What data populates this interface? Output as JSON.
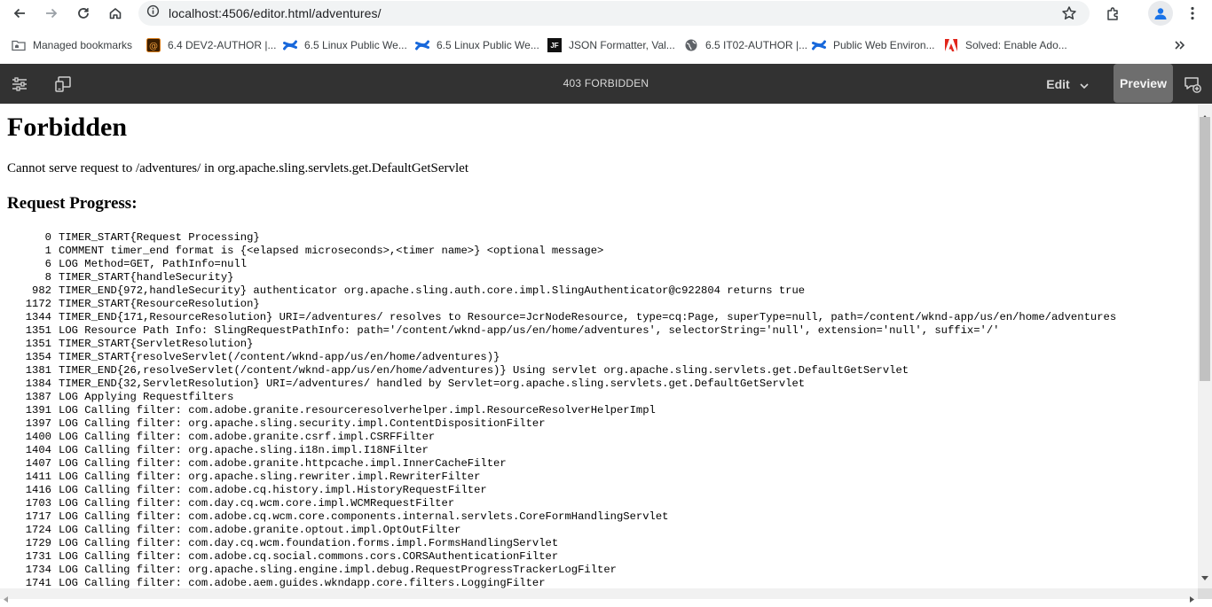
{
  "browser": {
    "url": "localhost:4506/editor.html/adventures/",
    "icons": [
      "back-icon",
      "forward-icon",
      "reload-icon",
      "home-icon",
      "site-info-icon",
      "bookmark-star-icon",
      "extensions-icon",
      "profile-icon",
      "browser-menu-icon"
    ]
  },
  "bookmarks": {
    "items": [
      {
        "label": "Managed bookmarks",
        "icon": "folder-icon"
      },
      {
        "label": "6.4 DEV2-AUTHOR |...",
        "icon": "aem-favicon"
      },
      {
        "label": "6.5 Linux Public We...",
        "icon": "confluence-favicon"
      },
      {
        "label": "6.5 Linux Public We...",
        "icon": "confluence-favicon"
      },
      {
        "label": "JSON Formatter, Val...",
        "icon": "jf-favicon"
      },
      {
        "label": "6.5 IT02-AUTHOR |...",
        "icon": "globe-favicon"
      },
      {
        "label": "Public Web Environ...",
        "icon": "confluence-favicon"
      },
      {
        "label": "Solved: Enable Ado...",
        "icon": "adobe-favicon"
      }
    ],
    "jf_favicon_text": "JF",
    "overflow_icon": "chevron-double-right-icon"
  },
  "editor": {
    "title": "403 FORBIDDEN",
    "mode_label": "Edit",
    "preview_label": "Preview",
    "icons": [
      "page-properties-icon",
      "emulator-icon",
      "annotate-icon"
    ]
  },
  "page": {
    "heading": "Forbidden",
    "message": "Cannot serve request to /adventures/ in org.apache.sling.servlets.get.DefaultGetServlet",
    "subheading": "Request Progress:",
    "log": [
      {
        "time": "0",
        "text": "TIMER_START{Request Processing}"
      },
      {
        "time": "1",
        "text": "COMMENT timer_end format is {<elapsed microseconds>,<timer name>} <optional message>"
      },
      {
        "time": "6",
        "text": "LOG Method=GET, PathInfo=null"
      },
      {
        "time": "8",
        "text": "TIMER_START{handleSecurity}"
      },
      {
        "time": "982",
        "text": "TIMER_END{972,handleSecurity} authenticator org.apache.sling.auth.core.impl.SlingAuthenticator@c922804 returns true"
      },
      {
        "time": "1172",
        "text": "TIMER_START{ResourceResolution}"
      },
      {
        "time": "1344",
        "text": "TIMER_END{171,ResourceResolution} URI=/adventures/ resolves to Resource=JcrNodeResource, type=cq:Page, superType=null, path=/content/wknd-app/us/en/home/adventures"
      },
      {
        "time": "1351",
        "text": "LOG Resource Path Info: SlingRequestPathInfo: path='/content/wknd-app/us/en/home/adventures', selectorString='null', extension='null', suffix='/'"
      },
      {
        "time": "1351",
        "text": "TIMER_START{ServletResolution}"
      },
      {
        "time": "1354",
        "text": "TIMER_START{resolveServlet(/content/wknd-app/us/en/home/adventures)}"
      },
      {
        "time": "1381",
        "text": "TIMER_END{26,resolveServlet(/content/wknd-app/us/en/home/adventures)} Using servlet org.apache.sling.servlets.get.DefaultGetServlet"
      },
      {
        "time": "1384",
        "text": "TIMER_END{32,ServletResolution} URI=/adventures/ handled by Servlet=org.apache.sling.servlets.get.DefaultGetServlet"
      },
      {
        "time": "1387",
        "text": "LOG Applying Requestfilters"
      },
      {
        "time": "1391",
        "text": "LOG Calling filter: com.adobe.granite.resourceresolverhelper.impl.ResourceResolverHelperImpl"
      },
      {
        "time": "1397",
        "text": "LOG Calling filter: org.apache.sling.security.impl.ContentDispositionFilter"
      },
      {
        "time": "1400",
        "text": "LOG Calling filter: com.adobe.granite.csrf.impl.CSRFFilter"
      },
      {
        "time": "1404",
        "text": "LOG Calling filter: org.apache.sling.i18n.impl.I18NFilter"
      },
      {
        "time": "1407",
        "text": "LOG Calling filter: com.adobe.granite.httpcache.impl.InnerCacheFilter"
      },
      {
        "time": "1411",
        "text": "LOG Calling filter: org.apache.sling.rewriter.impl.RewriterFilter"
      },
      {
        "time": "1416",
        "text": "LOG Calling filter: com.adobe.cq.history.impl.HistoryRequestFilter"
      },
      {
        "time": "1703",
        "text": "LOG Calling filter: com.day.cq.wcm.core.impl.WCMRequestFilter"
      },
      {
        "time": "1717",
        "text": "LOG Calling filter: com.adobe.cq.wcm.core.components.internal.servlets.CoreFormHandlingServlet"
      },
      {
        "time": "1724",
        "text": "LOG Calling filter: com.adobe.granite.optout.impl.OptOutFilter"
      },
      {
        "time": "1729",
        "text": "LOG Calling filter: com.day.cq.wcm.foundation.forms.impl.FormsHandlingServlet"
      },
      {
        "time": "1731",
        "text": "LOG Calling filter: com.adobe.cq.social.commons.cors.CORSAuthenticationFilter"
      },
      {
        "time": "1734",
        "text": "LOG Calling filter: org.apache.sling.engine.impl.debug.RequestProgressTrackerLogFilter"
      },
      {
        "time": "1741",
        "text": "LOG Calling filter: com.adobe.aem.guides.wkndapp.core.filters.LoggingFilter"
      }
    ]
  },
  "colors": {
    "editor_bar": "#323232",
    "preview_button": "#6e6e6e",
    "omnibox": "#f1f3f4",
    "confluence_blue": "#1868db",
    "adobe_red": "#e1251b"
  }
}
